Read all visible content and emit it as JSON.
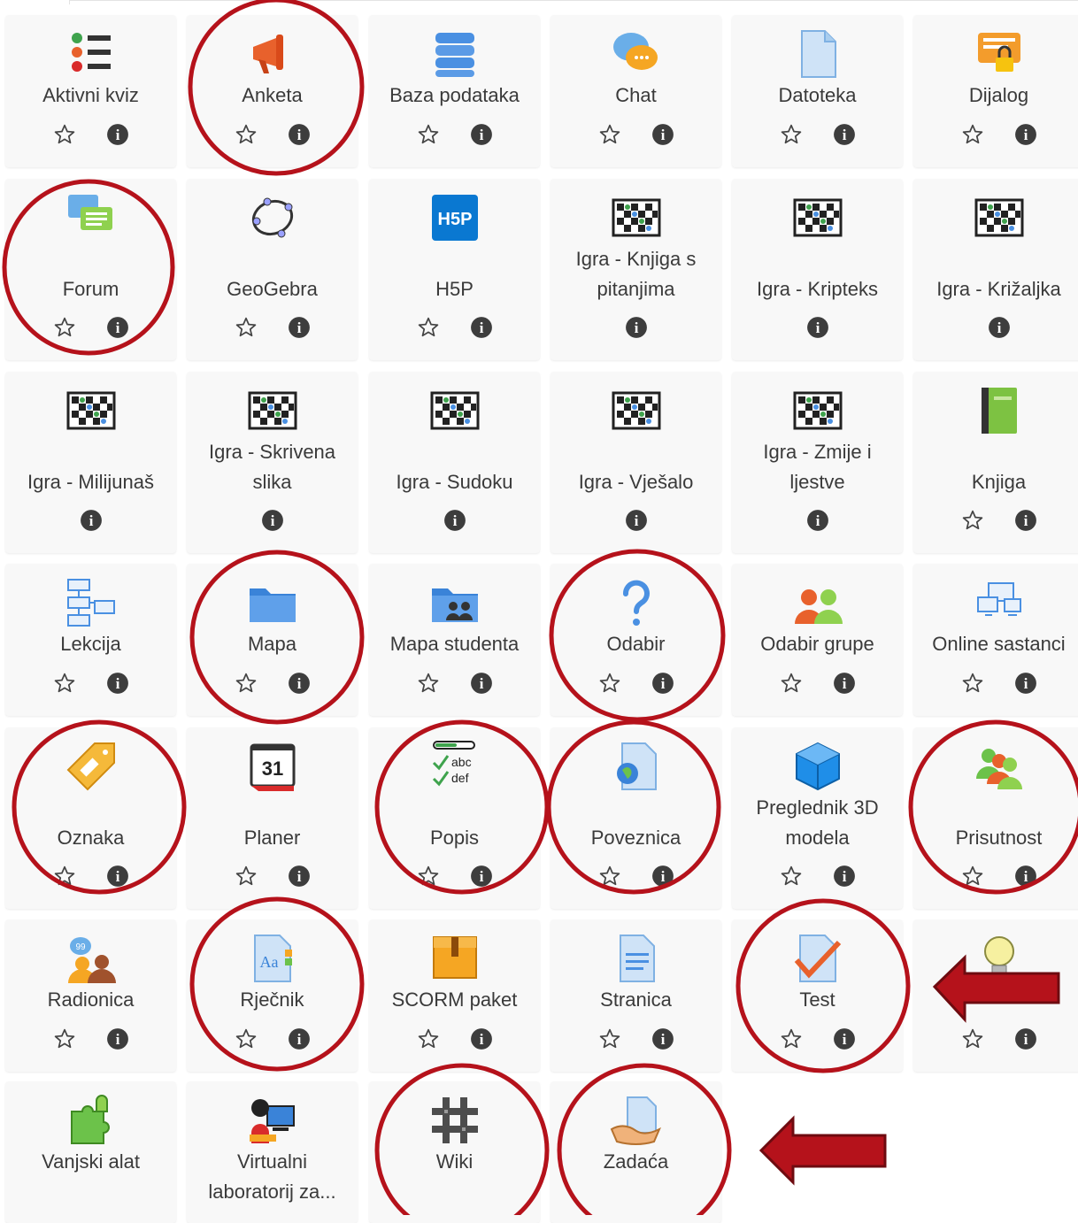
{
  "tiles": [
    {
      "label": "Aktivni kviz",
      "icon": "quiz-list-icon",
      "star": true
    },
    {
      "label": "Anketa",
      "icon": "megaphone-icon",
      "star": true
    },
    {
      "label": "Baza podataka",
      "icon": "database-icon",
      "star": true
    },
    {
      "label": "Chat",
      "icon": "chat-bubbles-icon",
      "star": true
    },
    {
      "label": "Datoteka",
      "icon": "file-icon",
      "star": true
    },
    {
      "label": "Dijalog",
      "icon": "dialog-lock-icon",
      "star": true
    },
    {
      "label": "Forum",
      "icon": "forum-icon",
      "star": true
    },
    {
      "label": "GeoGebra",
      "icon": "geogebra-icon",
      "star": true
    },
    {
      "label": "H5P",
      "icon": "h5p-icon",
      "star": true
    },
    {
      "label": "Igra - Knjiga s pitanjima",
      "icon": "game-board-icon",
      "star": false
    },
    {
      "label": "Igra - Kripteks",
      "icon": "game-board-icon",
      "star": false
    },
    {
      "label": "Igra - Križaljka",
      "icon": "game-board-icon",
      "star": false
    },
    {
      "label": "Igra - Milijunaš",
      "icon": "game-board-icon",
      "star": false
    },
    {
      "label": "Igra - Skrivena slika",
      "icon": "game-board-icon",
      "star": false
    },
    {
      "label": "Igra - Sudoku",
      "icon": "game-board-icon",
      "star": false
    },
    {
      "label": "Igra - Vješalo",
      "icon": "game-board-icon",
      "star": false
    },
    {
      "label": "Igra - Zmije i ljestve",
      "icon": "game-board-icon",
      "star": false
    },
    {
      "label": "Knjiga",
      "icon": "book-icon",
      "star": true
    },
    {
      "label": "Lekcija",
      "icon": "lesson-flow-icon",
      "star": true
    },
    {
      "label": "Mapa",
      "icon": "folder-icon",
      "star": true
    },
    {
      "label": "Mapa studenta",
      "icon": "student-folder-icon",
      "star": true
    },
    {
      "label": "Odabir",
      "icon": "question-mark-icon",
      "star": true
    },
    {
      "label": "Odabir grupe",
      "icon": "group-choice-icon",
      "star": true
    },
    {
      "label": "Online sastanci",
      "icon": "online-meeting-icon",
      "star": true
    },
    {
      "label": "Oznaka",
      "icon": "tag-icon",
      "star": true
    },
    {
      "label": "Planer",
      "icon": "calendar-icon",
      "star": true
    },
    {
      "label": "Popis",
      "icon": "checklist-icon",
      "star": true
    },
    {
      "label": "Poveznica",
      "icon": "url-globe-icon",
      "star": true
    },
    {
      "label": "Preglednik 3D modela",
      "icon": "cube-icon",
      "star": true
    },
    {
      "label": "Prisutnost",
      "icon": "attendance-icon",
      "star": true
    },
    {
      "label": "Radionica",
      "icon": "workshop-icon",
      "star": true
    },
    {
      "label": "Rječnik",
      "icon": "glossary-icon",
      "star": true
    },
    {
      "label": "SCORM paket",
      "icon": "scorm-box-icon",
      "star": true
    },
    {
      "label": "Stranica",
      "icon": "page-icon",
      "star": true
    },
    {
      "label": "Test",
      "icon": "test-check-icon",
      "star": true
    },
    {
      "label": "",
      "icon": "lightbulb-icon",
      "star": true
    },
    {
      "label": "Vanjski alat",
      "icon": "puzzle-icon",
      "star": false
    },
    {
      "label": "Virtualni laboratorij za...",
      "icon": "virtual-lab-icon",
      "star": false
    },
    {
      "label": "Wiki",
      "icon": "wiki-icon",
      "star": false
    },
    {
      "label": "Zadaća",
      "icon": "assignment-icon",
      "star": false
    }
  ],
  "glyphs": {
    "info": "i"
  },
  "colors": {
    "annotation": "#b5121b",
    "tile_bg": "#f8f8f8",
    "icon_blue": "#4a90e2",
    "info_dark": "#3d3d3d"
  }
}
